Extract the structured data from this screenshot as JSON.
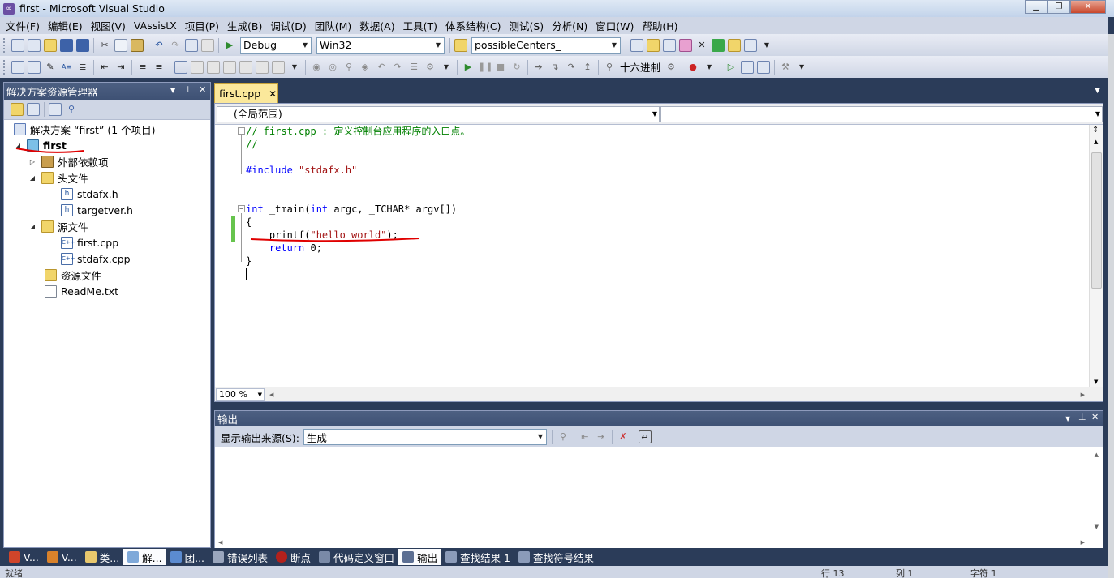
{
  "window": {
    "title": "first - Microsoft Visual Studio",
    "min_glyph": "▁",
    "max_glyph": "❐",
    "close_glyph": "✕"
  },
  "menu": [
    "文件(F)",
    "编辑(E)",
    "视图(V)",
    "VAssistX",
    "项目(P)",
    "生成(B)",
    "调试(D)",
    "团队(M)",
    "数据(A)",
    "工具(T)",
    "体系结构(C)",
    "测试(S)",
    "分析(N)",
    "窗口(W)",
    "帮助(H)"
  ],
  "toolbar": {
    "config": "Debug",
    "platform": "Win32",
    "find_combo": "possibleCenters_",
    "hex_label": "十六进制"
  },
  "solution_explorer": {
    "title": "解决方案资源管理器",
    "pin_glyph": "📌",
    "tree": {
      "solution": "解决方案 “first” (1 个项目)",
      "project": "first",
      "ext_deps": "外部依赖项",
      "header_folder": "头文件",
      "stdafx_h": "stdafx.h",
      "targetver_h": "targetver.h",
      "source_folder": "源文件",
      "first_cpp": "first.cpp",
      "stdafx_cpp": "stdafx.cpp",
      "resource_folder": "资源文件",
      "readme": "ReadMe.txt"
    }
  },
  "editor": {
    "tab_label": "first.cpp",
    "scope_combo": "(全局范围)",
    "member_combo": "",
    "zoom": "100 %",
    "code": {
      "l1": "// first.cpp : 定义控制台应用程序的入口点。",
      "l2": "//",
      "l4_kw": "#include",
      "l4_str": " \"stdafx.h\"",
      "l7_kw": "int",
      "l7_rest": " _tmain(",
      "l7_kw2": "int",
      "l7_rest2": " argc, _TCHAR* argv[])",
      "l8": "{",
      "l9_pre": "    printf(",
      "l9_str": "\"hello world\"",
      "l9_post": ");",
      "l10_kw": "    return",
      "l10_rest": " 0;",
      "l11": "}"
    }
  },
  "output": {
    "title": "输出",
    "source_label": "显示输出来源(S):",
    "source_value": "生成"
  },
  "bottom_tabs": [
    "V...",
    "V...",
    "类...",
    "解...",
    "团...",
    "错误列表",
    "断点",
    "代码定义窗口",
    "输出",
    "查找结果 1",
    "查找符号结果"
  ],
  "status": {
    "ready": "就绪",
    "line": "行 13",
    "col": "列 1",
    "ch": "字符 1"
  },
  "colors": {
    "accent_panel": "#3e5174",
    "active_tab": "#fbe89b",
    "annotation": "#e00000"
  }
}
